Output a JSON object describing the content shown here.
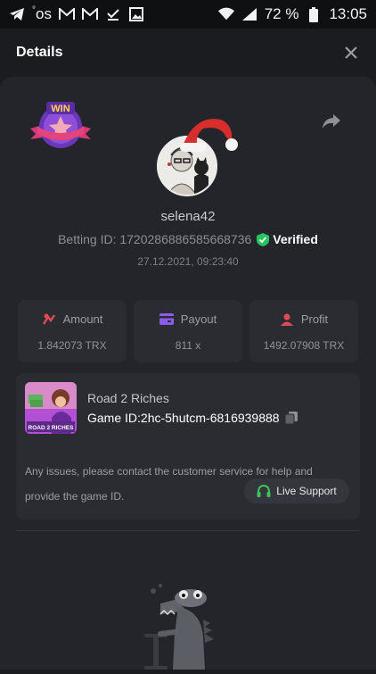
{
  "status_bar": {
    "left_icons": [
      "telegram-icon",
      "os-icon",
      "gmail-icon",
      "gmail-icon",
      "check-icon",
      "image-icon"
    ],
    "left_text": "os",
    "battery": "72 %",
    "time": "13:05"
  },
  "header": {
    "title": "Details"
  },
  "bet": {
    "username": "selena42",
    "betting_id_label": "Betting ID: 1720286886585668736",
    "verified": "Verified",
    "timestamp": "27.12.2021, 09:23:40",
    "badge_text": "WIN"
  },
  "stats": [
    {
      "label": "Amount",
      "value": "1.842073 TRX",
      "icon": "amount-icon",
      "color": "#e24a5a"
    },
    {
      "label": "Payout",
      "value": "811 x",
      "icon": "payout-icon",
      "color": "#8a5cf0"
    },
    {
      "label": "Profit",
      "value": "1492.07908 TRX",
      "icon": "profit-icon",
      "color": "#e24a5a"
    }
  ],
  "game": {
    "name": "Road 2 Riches",
    "game_id": "Game ID:2hc-5hutcm-6816939888",
    "thumb_text": "ROAD 2 RICHES",
    "issues_text": "Any issues, please contact the customer service for help and provide the game ID.",
    "support_label": "Live Support"
  },
  "colors": {
    "background": "#1b1c1f",
    "sheet": "#23252a",
    "card": "#2a2c32",
    "verified_green": "#27c35f",
    "support_green": "#3ec45a"
  }
}
